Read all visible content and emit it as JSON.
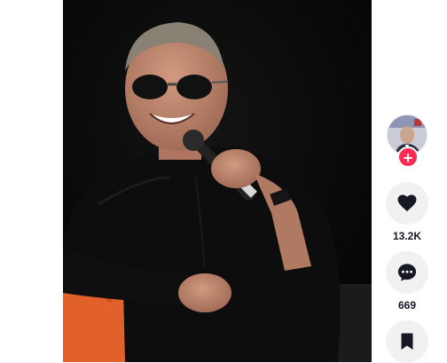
{
  "video": {
    "description_icon": "video-frame"
  },
  "profile": {
    "follow_symbol": "+"
  },
  "actions": {
    "like": {
      "icon": "heart-icon",
      "count": "13.2K"
    },
    "comment": {
      "icon": "comment-icon",
      "count": "669"
    },
    "save": {
      "icon": "bookmark-icon"
    }
  },
  "colors": {
    "accent": "#fe2c55",
    "action_bg": "#f1f1f2",
    "text": "#161823"
  }
}
